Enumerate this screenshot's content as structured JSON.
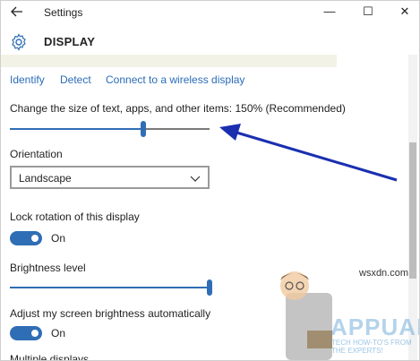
{
  "window": {
    "title": "Settings",
    "back_icon": "back-arrow-icon",
    "minimize_glyph": "—",
    "maximize_glyph": "☐",
    "close_glyph": "✕"
  },
  "header": {
    "icon": "gear-icon",
    "title": "DISPLAY"
  },
  "links": {
    "identify": "Identify",
    "detect": "Detect",
    "connect": "Connect to a wireless display"
  },
  "scale": {
    "label": "Change the size of text, apps, and other items: 150% (Recommended)",
    "value_fraction": 0.67
  },
  "orientation": {
    "label": "Orientation",
    "selected": "Landscape"
  },
  "lock_rotation": {
    "label": "Lock rotation of this display",
    "state": "On"
  },
  "brightness": {
    "label": "Brightness level",
    "value_fraction": 1.0
  },
  "auto_brightness": {
    "label": "Adjust my screen brightness automatically",
    "state": "On"
  },
  "partial_next": "Multiple displays",
  "watermark": {
    "brand": "APPUALS",
    "tagline": "TECH HOW-TO'S FROM THE EXPERTS!",
    "site": "wsxdn.com"
  },
  "colors": {
    "accent": "#2f6eb5",
    "link": "#2b6cb8",
    "annotation_arrow": "#1a2fb0"
  }
}
